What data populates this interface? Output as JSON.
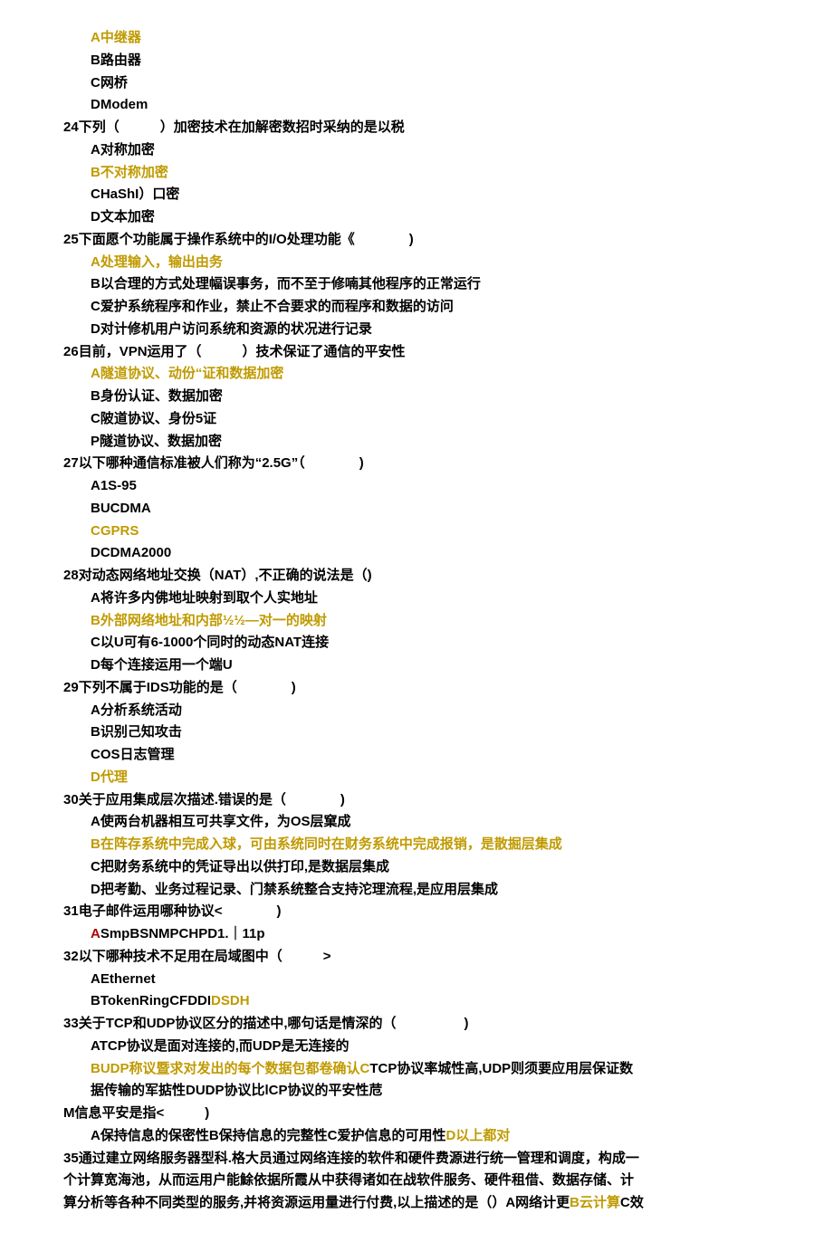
{
  "questions": [
    {
      "num": "",
      "stem": "",
      "options": [
        {
          "label": "A",
          "text": "中继器",
          "hl": true
        },
        {
          "label": "B",
          "text": "路由器",
          "hl": false
        },
        {
          "label": "C",
          "text": "网桥",
          "hl": false
        },
        {
          "label": "D",
          "text": "Modem",
          "hl": false
        }
      ]
    },
    {
      "num": "24",
      "stem": "下列（　　　）加密技术在加解密数招时采纳的是以税",
      "options": [
        {
          "label": "A",
          "text": "对称加密",
          "hl": false
        },
        {
          "label": "B",
          "text": "不对称加密",
          "hl": true
        },
        {
          "label": "C",
          "text": "HaShI）口密",
          "hl": false
        },
        {
          "label": "D",
          "text": "文本加密",
          "hl": false
        }
      ]
    },
    {
      "num": "25",
      "stem": "下面愿个功能属于操作系统中的I/O处理功能《　　　　)",
      "options": [
        {
          "label": "A",
          "text": "处理输入，输出由务",
          "hl": true
        },
        {
          "label": "B",
          "text": "以合理的方式处理幅误事务，而不至于修喃其他程序的正常运行",
          "hl": false
        },
        {
          "label": "C",
          "text": "爱护系统程序和作业，禁止不合要求的而程序和数据的访问",
          "hl": false
        },
        {
          "label": "D",
          "text": "对计修机用户访问系统和资源的状况进行记录",
          "hl": false
        }
      ]
    },
    {
      "num": "26",
      "stem": "目前，VPN运用了（　　　）技术保证了通信的平安性",
      "options": [
        {
          "label": "A",
          "text": "隧道协议、动份“证和数据加密",
          "hl": true
        },
        {
          "label": "B",
          "text": "身份认证、数据加密",
          "hl": false
        },
        {
          "label": "C",
          "text": "陂道协议、身份5证",
          "hl": false
        },
        {
          "label": "P",
          "text": "隧道协议、数据加密",
          "hl": false
        }
      ]
    },
    {
      "num": "27",
      "stem": "以下哪种通信标准被人们称为“2.5G”（　　　　)",
      "options": [
        {
          "label": "A",
          "text": "1S-95",
          "hl": false
        },
        {
          "label": "B",
          "text": "UCDMA",
          "hl": false
        },
        {
          "label": "C",
          "text": "GPRS",
          "hl": true
        },
        {
          "label": "D",
          "text": "CDMA2000",
          "hl": false
        }
      ]
    },
    {
      "num": "28",
      "stem": "对动态网络地址交换（NAT）,不正确的说法是（)",
      "options": [
        {
          "label": "A",
          "text": "将许多内佛地址映射到取个人实地址",
          "hl": false
        },
        {
          "label": "B",
          "text": "外部网络地址和内部½½—对一的映射",
          "hl": true
        },
        {
          "label": "C",
          "text": "以U可有6-1000个同时的动态NAT连接",
          "hl": false
        },
        {
          "label": "D",
          "text": "每个连接运用一个端U",
          "hl": false
        }
      ]
    },
    {
      "num": "29",
      "stem": "下列不属于IDS功能的是（　　　　)",
      "options": [
        {
          "label": "A",
          "text": "分析系统活动",
          "hl": false
        },
        {
          "label": "B",
          "text": "识别己知攻击",
          "hl": false
        },
        {
          "label": "C",
          "text": "OS日志管理",
          "hl": false
        },
        {
          "label": "D",
          "text": "代理",
          "hl": true
        }
      ]
    },
    {
      "num": "30",
      "stem": "关于应用集成层次描述.错误的是（　　　　)",
      "options": [
        {
          "label": "A",
          "text": "使两台机器相互可共享文件，为OS层窠成",
          "hl": false
        },
        {
          "label": "B",
          "text": "在阵存系统中完成入球，可由系统同时在财务系统中完成报销，是散掘层集成",
          "hl": true
        },
        {
          "label": "C",
          "text": "把财务系统中的凭证导出以供打印,是数据层集成",
          "hl": false
        },
        {
          "label": "D",
          "text": "把考勤、业务过程记录、门禁系统整合支持沱理流程,是应用层集成",
          "hl": false
        }
      ]
    }
  ],
  "q31": {
    "num": "31",
    "stem": "电子邮件运用哪种协议<　　　　)",
    "opts_line": {
      "a_label": "A",
      "a_text": "Smp",
      "rest": "BSNMPCHPD1.｜11p"
    }
  },
  "q32": {
    "num": "32",
    "stem": "以下哪种技术不足用在局域图中（　　　>",
    "line1": "AEthernet",
    "line2_prefix": "BTokenRingCFDDI",
    "line2_hl": "DSDH"
  },
  "q33": {
    "num": "33",
    "stem": "关于TCP和UDP协议区分的描述中,哪句话是情深的（　　　　　)",
    "optA": "ATCP协议是面对连接的,而UDP是无连接的",
    "optB_hl": "BUDP称议暨求对发出的每个数据包都卷确认C",
    "optB_rest1": "TCP协议率城性高,UDP则须要应用层保证数",
    "optB_line2": "据传输的军掂性DUDP协议比lCP协议的平安性苊"
  },
  "qM": {
    "num": "M",
    "stem": "信息平安是指<　　　)",
    "line_prefix": "A保持信息的保密性B保持信息的完整性C爱护信息的可用性",
    "line_hl": "D以上都对"
  },
  "q35": {
    "num": "35",
    "stem": "通过建立网络服务器型科.格大员通过网络连接的软件和硬件费源进行统一管理和调度，构成一",
    "line2": "个计算宽海池，从而运用户能鮽依据所霞从中获得诸如在战软件服务、硬件租借、数据存储、计",
    "line3_prefix": "算分析等各种不同类型的服务,并将资源运用量进行付费,以上描述的是（）A网络计更",
    "line3_hl": "B云计算",
    "line3_suffix": "C效"
  }
}
